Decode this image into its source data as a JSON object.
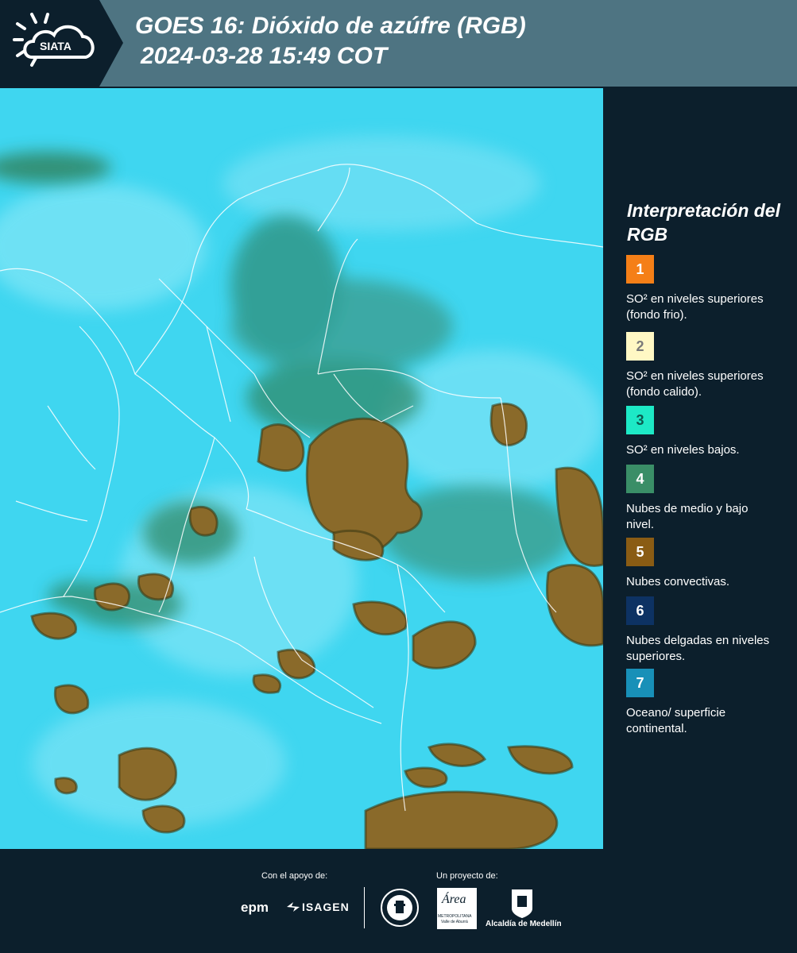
{
  "header": {
    "logo_text": "SIATA",
    "title_line1": "GOES 16: Dióxido de azúfre (RGB)",
    "title_line2": "2024-03-28 15:49 COT"
  },
  "map": {
    "description_icon": "satellite-rgb-map",
    "colors": {
      "ocean": "#3fd6f0",
      "convective": "#8a6a2a",
      "low_cloud": "#2f6e4a"
    }
  },
  "legend": {
    "title": "Interpretación del RGB",
    "items": [
      {
        "number": "1",
        "color": "#f57f17",
        "text": "SO² en niveles superiores (fondo frio)."
      },
      {
        "number": "2",
        "color": "#fff8c4",
        "text": "SO² en niveles superiores (fondo calido)."
      },
      {
        "number": "3",
        "color": "#1de9c6",
        "text": "SO² en niveles bajos."
      },
      {
        "number": "4",
        "color": "#3a8e67",
        "text": "Nubes de medio y bajo nivel."
      },
      {
        "number": "5",
        "color": "#8a5c14",
        "text": "Nubes convectivas."
      },
      {
        "number": "6",
        "color": "#0d3263",
        "text": "Nubes delgadas en niveles superiores."
      },
      {
        "number": "7",
        "color": "#1890b8",
        "text": "Oceano/ superficie continental."
      }
    ]
  },
  "footer": {
    "support_label": "Con el apoyo de:",
    "project_label": "Un proyecto de:",
    "sponsor_epm": "epm",
    "sponsor_isagen": "ISAGEN",
    "area_label": "Área",
    "area_sub1": "METROPOLITANA",
    "area_sub2": "Valle de Aburrá",
    "alcaldia": "Alcaldía de Medellín"
  }
}
